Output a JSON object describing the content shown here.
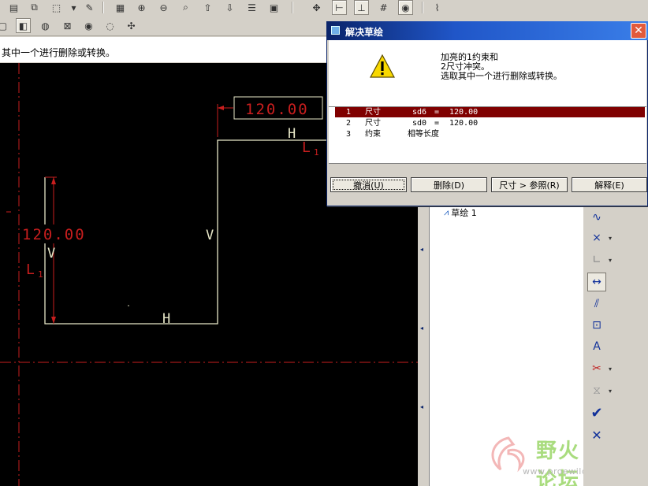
{
  "prompt_message": "其中一个进行删除或转换。",
  "sketch": {
    "dim_horizontal": "120.00",
    "dim_vertical": "120.00",
    "constraint_h": "H",
    "constraint_v": "V",
    "constraint_l": "L",
    "constraint_l_sub": "1"
  },
  "dialog": {
    "title": "解决草绘",
    "message_lines": [
      "加亮的1约束和",
      "2尺寸冲突。",
      "选取其中一个进行删除或转换。"
    ],
    "rows": [
      {
        "index": "1",
        "kind": "尺寸",
        "name": "sd6",
        "eq": "=",
        "value": "120.00",
        "selected": true
      },
      {
        "index": "2",
        "kind": "尺寸",
        "name": "sd0",
        "eq": "=",
        "value": "120.00",
        "selected": false
      },
      {
        "index": "3",
        "kind": "约束",
        "name": "相等长度",
        "eq": "",
        "value": "",
        "selected": false
      }
    ],
    "buttons": {
      "undo": "撤消(U)",
      "delete": "删除(D)",
      "dim_to_ref": "尺寸 > 参照(R)",
      "explain": "解释(E)"
    }
  },
  "model_tree": {
    "item": "草绘 1"
  },
  "watermark": {
    "text": "野火论坛",
    "url": "www.proewildfire.cn"
  },
  "colors": {
    "canvas": "#000000",
    "sketch_line": "#e8e8c8",
    "dimension": "#c81e1e",
    "selection": "#800000",
    "title_bar": "#0a246a"
  }
}
